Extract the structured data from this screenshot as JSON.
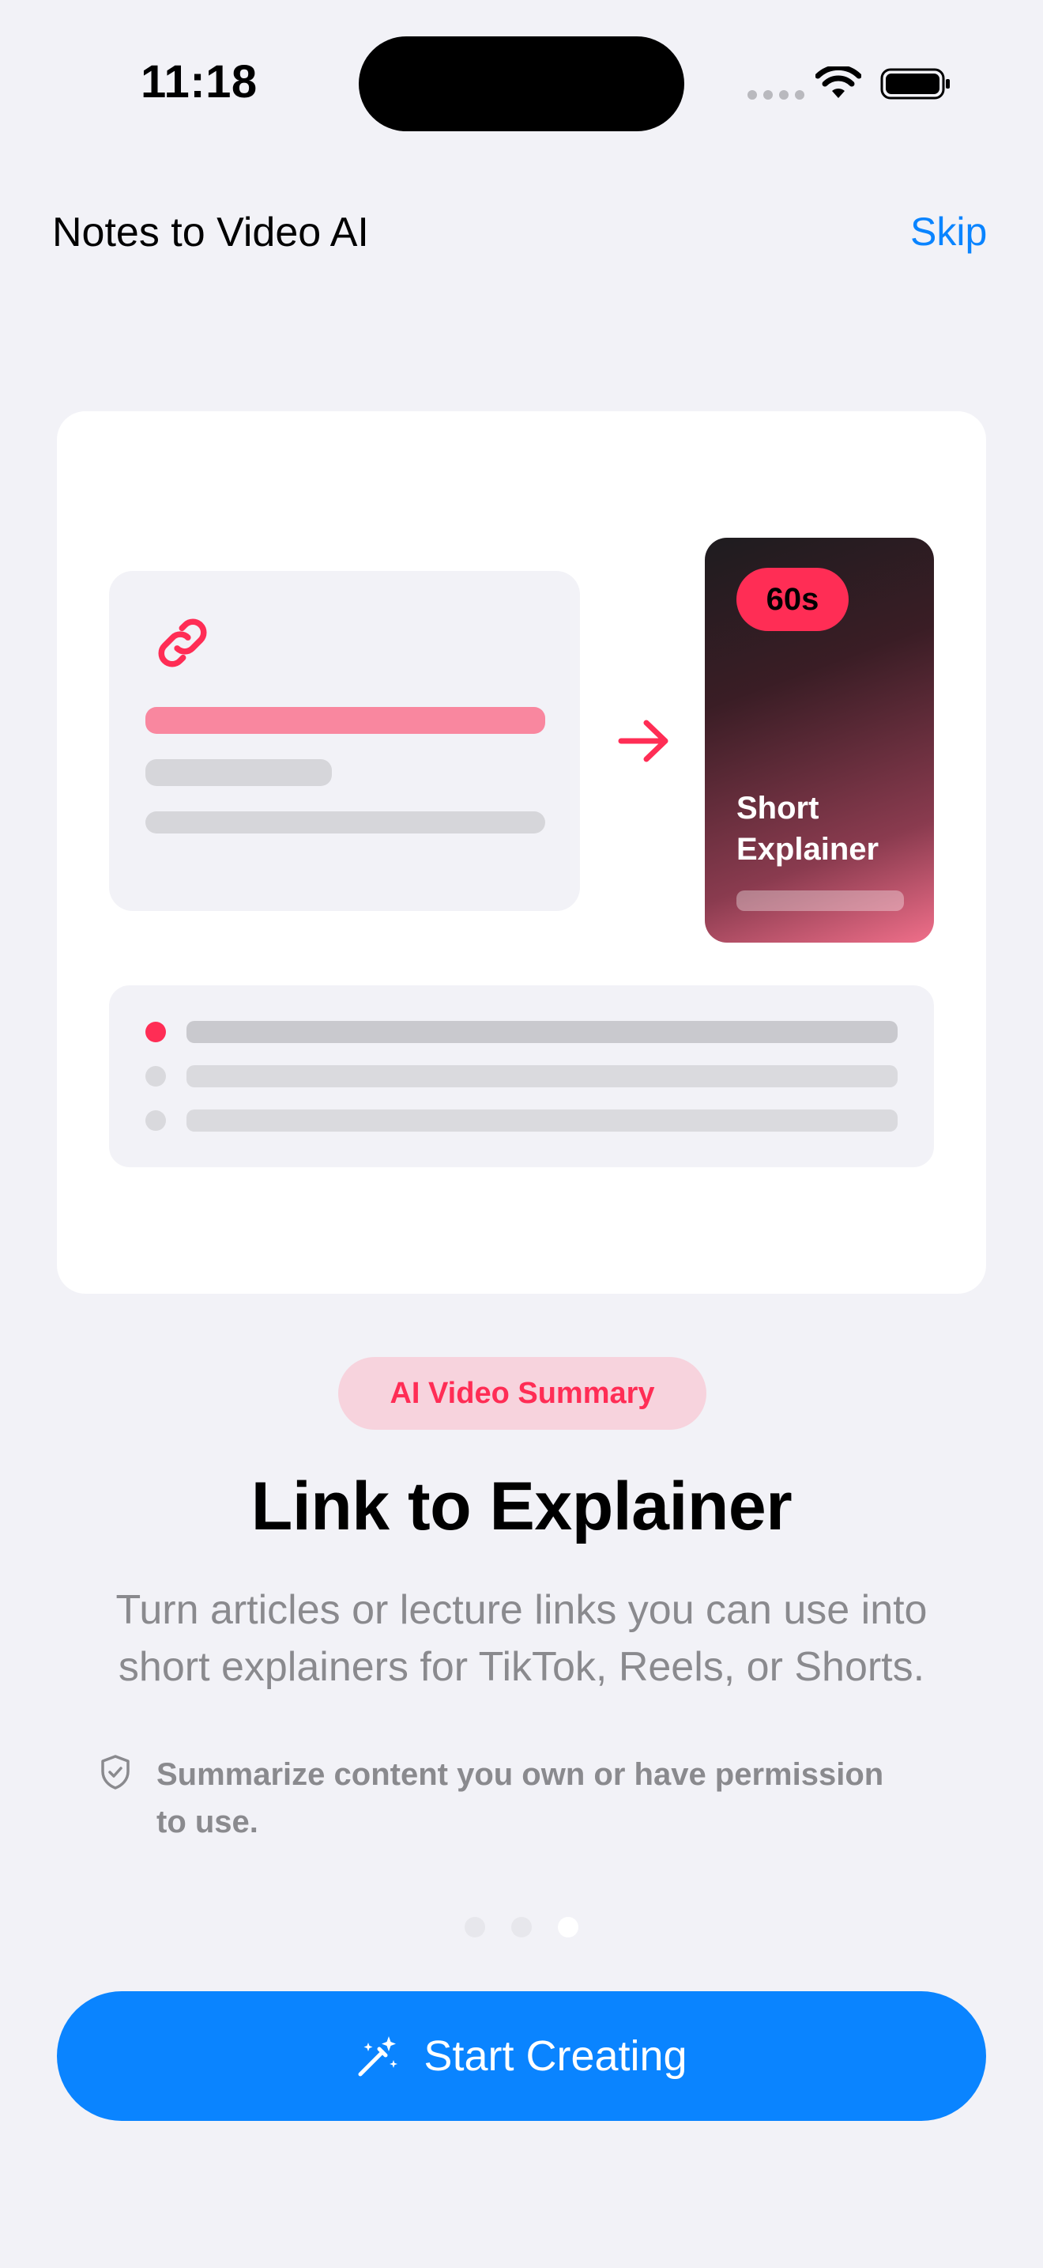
{
  "status_bar": {
    "time": "11:18"
  },
  "header": {
    "title": "Notes to Video AI",
    "skip_label": "Skip"
  },
  "illustration": {
    "video_duration": "60s",
    "video_title_line1": "Short",
    "video_title_line2": "Explainer"
  },
  "content": {
    "tag": "AI Video Summary",
    "headline": "Link to Explainer",
    "subtitle_line1": "Turn articles or lecture links you can use into",
    "subtitle_line2": "short explainers for TikTok, Reels, or Shorts.",
    "disclaimer_line1": "Summarize content you own or have permission",
    "disclaimer_line2": "to use."
  },
  "pagination": {
    "total": 3,
    "current": 3
  },
  "cta": {
    "label": "Start Creating"
  },
  "colors": {
    "accent_blue": "#0a84ff",
    "accent_pink": "#ff2d55",
    "background": "#f2f2f7"
  },
  "icons": {
    "link": "link-icon",
    "arrow": "arrow-right-icon",
    "shield": "shield-check-icon",
    "wand": "magic-wand-icon",
    "wifi": "wifi-icon",
    "battery": "battery-icon"
  }
}
